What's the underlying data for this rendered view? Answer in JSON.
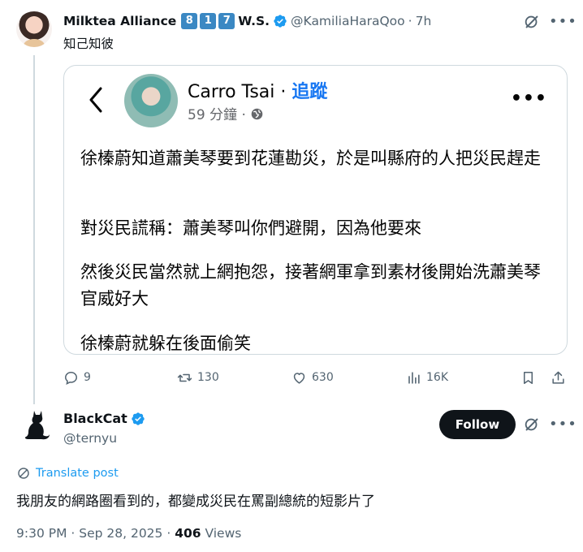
{
  "tweet1": {
    "author_name": "Milktea Alliance",
    "badges": [
      "8",
      "1",
      "7"
    ],
    "author_suffix": "W.S.",
    "handle": "@KamiliaHaraQoo",
    "separator": "·",
    "time": "7h",
    "text": "知己知彼",
    "embedded_post": {
      "author": "Carro Tsai",
      "dot": "·",
      "follow_label": "追蹤",
      "meta": "59 分鐘 ·",
      "paragraphs": [
        "徐榛蔚知道蕭美琴要到花蓮勘災，於是叫縣府的人把災民趕走",
        "對災民謊稱：蕭美琴叫你們避開，因為他要來",
        "然後災民當然就上網抱怨，接著網軍拿到素材後開始洗蕭美琴官威好大",
        "徐榛蔚就躲在後面偷笑"
      ]
    },
    "stats": {
      "replies": "9",
      "reposts": "130",
      "likes": "630",
      "views": "16K"
    }
  },
  "tweet2": {
    "author_name": "BlackCat",
    "handle": "@ternyu",
    "follow_label": "Follow",
    "translate_label": "Translate post",
    "text": "我朋友的網路圈看到的，都變成災民在罵副總統的短影片了",
    "timestamp": "9:30 PM · Sep 28, 2025 · ",
    "views_count": "406",
    "views_label": " Views"
  },
  "colors": {
    "accent": "#1d9bf0",
    "facebook_blue": "#1877f2",
    "badge_blue": "#3b88c3",
    "muted": "#536471"
  },
  "icons": [
    "verified-icon",
    "grok-icon",
    "more-icon",
    "back-icon",
    "globe-icon",
    "reply-icon",
    "repost-icon",
    "like-icon",
    "views-icon",
    "bookmark-icon",
    "share-icon",
    "translate-icon",
    "black-cat-avatar"
  ]
}
